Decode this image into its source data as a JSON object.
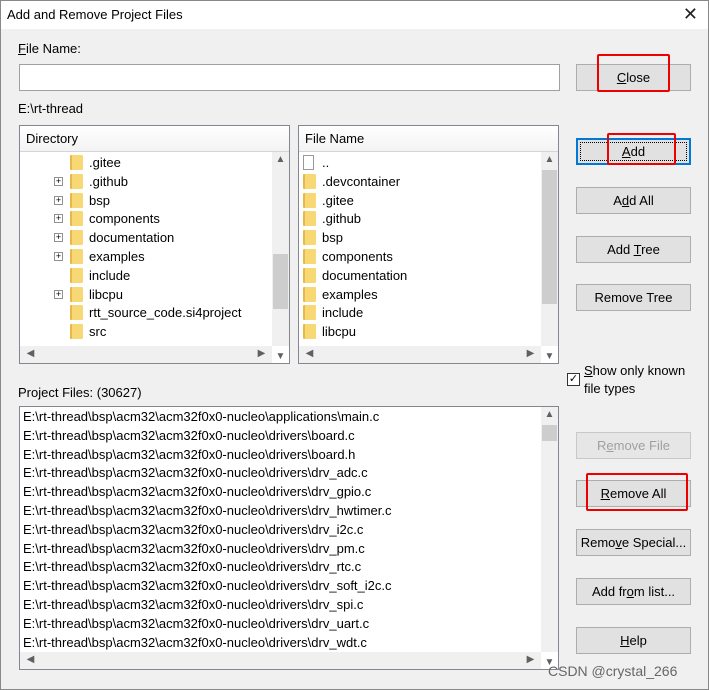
{
  "window": {
    "title": "Add and Remove Project Files",
    "close_glyph": "✕"
  },
  "file_name": {
    "label": "File Name:",
    "mnemonic": "F",
    "value": "",
    "placeholder": ""
  },
  "current_path": "E:\\rt-thread",
  "directory": {
    "header": "Directory",
    "items": [
      {
        "name": ".gitee",
        "expandable": false
      },
      {
        "name": ".github",
        "expandable": true
      },
      {
        "name": "bsp",
        "expandable": true
      },
      {
        "name": "components",
        "expandable": true
      },
      {
        "name": "documentation",
        "expandable": true
      },
      {
        "name": "examples",
        "expandable": true
      },
      {
        "name": "include",
        "expandable": false
      },
      {
        "name": "libcpu",
        "expandable": true
      },
      {
        "name": "rtt_source_code.si4project",
        "expandable": false
      },
      {
        "name": "src",
        "expandable": false
      }
    ]
  },
  "files": {
    "header": "File Name",
    "items": [
      {
        "name": "..",
        "icon": "file-icon"
      },
      {
        "name": ".devcontainer",
        "icon": "folder-icon"
      },
      {
        "name": ".gitee",
        "icon": "folder-icon"
      },
      {
        "name": ".github",
        "icon": "folder-icon"
      },
      {
        "name": "bsp",
        "icon": "folder-icon"
      },
      {
        "name": "components",
        "icon": "folder-icon"
      },
      {
        "name": "documentation",
        "icon": "folder-icon"
      },
      {
        "name": "examples",
        "icon": "folder-icon"
      },
      {
        "name": "include",
        "icon": "folder-icon"
      },
      {
        "name": "libcpu",
        "icon": "folder-icon"
      }
    ]
  },
  "show_known": {
    "label_line1": "Show only known",
    "label_line2": "file types",
    "mnemonic": "S",
    "checked": true
  },
  "project_files": {
    "label": "Project Files: (30627)",
    "items": [
      "E:\\rt-thread\\bsp\\acm32\\acm32f0x0-nucleo\\applications\\main.c",
      "E:\\rt-thread\\bsp\\acm32\\acm32f0x0-nucleo\\drivers\\board.c",
      "E:\\rt-thread\\bsp\\acm32\\acm32f0x0-nucleo\\drivers\\board.h",
      "E:\\rt-thread\\bsp\\acm32\\acm32f0x0-nucleo\\drivers\\drv_adc.c",
      "E:\\rt-thread\\bsp\\acm32\\acm32f0x0-nucleo\\drivers\\drv_gpio.c",
      "E:\\rt-thread\\bsp\\acm32\\acm32f0x0-nucleo\\drivers\\drv_hwtimer.c",
      "E:\\rt-thread\\bsp\\acm32\\acm32f0x0-nucleo\\drivers\\drv_i2c.c",
      "E:\\rt-thread\\bsp\\acm32\\acm32f0x0-nucleo\\drivers\\drv_pm.c",
      "E:\\rt-thread\\bsp\\acm32\\acm32f0x0-nucleo\\drivers\\drv_rtc.c",
      "E:\\rt-thread\\bsp\\acm32\\acm32f0x0-nucleo\\drivers\\drv_soft_i2c.c",
      "E:\\rt-thread\\bsp\\acm32\\acm32f0x0-nucleo\\drivers\\drv_spi.c",
      "E:\\rt-thread\\bsp\\acm32\\acm32f0x0-nucleo\\drivers\\drv_uart.c",
      "E:\\rt-thread\\bsp\\acm32\\acm32f0x0-nucleo\\drivers\\drv_wdt.c"
    ]
  },
  "buttons": {
    "close": {
      "label": "Close",
      "mnemonic": "C"
    },
    "add": {
      "label": "Add",
      "mnemonic": "A"
    },
    "add_all": {
      "label": "Add All",
      "mnemonic": "d"
    },
    "add_tree": {
      "label": "Add Tree",
      "mnemonic": "T"
    },
    "remove_tree": {
      "label": "Remove Tree"
    },
    "remove_file": {
      "label": "Remove File",
      "mnemonic": "e",
      "disabled": true
    },
    "remove_all": {
      "label": "Remove All",
      "mnemonic": "R"
    },
    "remove_special": {
      "label": "Remove Special...",
      "mnemonic": "v"
    },
    "add_from_list": {
      "label": "Add from list...",
      "mnemonic": "o"
    },
    "help": {
      "label": "Help",
      "mnemonic": "H"
    }
  },
  "highlight_color": "#e00000",
  "watermark": "CSDN @crystal_266"
}
